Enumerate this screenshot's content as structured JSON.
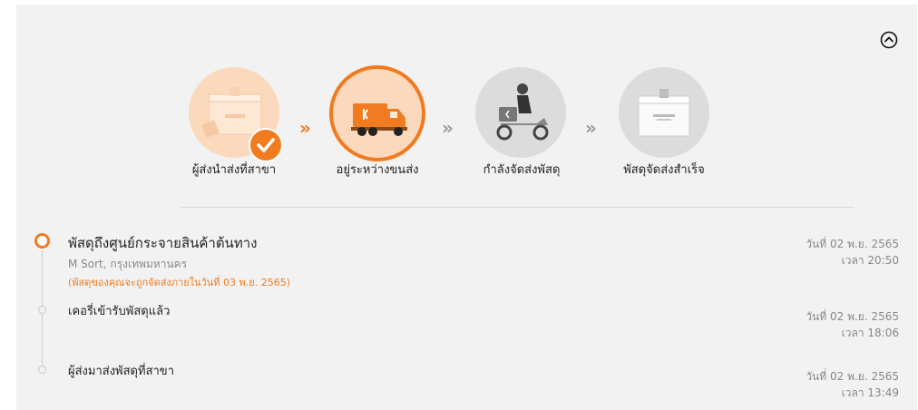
{
  "steps": [
    {
      "label": "ผู้ส่งนำส่งที่สาขา",
      "status": "completed",
      "icon": "parcel-box-icon",
      "badge_icon": "check-icon"
    },
    {
      "label": "อยู่ระหว่างขนส่ง",
      "status": "current",
      "icon": "delivery-truck-icon"
    },
    {
      "label": "กำลังจัดส่งพัสดุ",
      "status": "pending",
      "icon": "motorcycle-courier-icon"
    },
    {
      "label": "พัสดุจัดส่งสำเร็จ",
      "status": "pending",
      "icon": "delivered-box-icon"
    }
  ],
  "arrows": [
    "»",
    "»",
    "»"
  ],
  "colors": {
    "accent": "#f07b20",
    "accent_light": "#fbd9bd",
    "inactive": "#dcdcdc",
    "panel_bg": "#f2f2f2"
  },
  "timeline": [
    {
      "title": "พัสดุถึงศูนย์กระจายสินค้าต้นทาง",
      "location": "M Sort, กรุงเทพมหานคร",
      "note": "(พัสดุของคุณจะถูกจัดส่งภายในวันที่ 03 พ.ย. 2565)",
      "date": "วันที่ 02 พ.ย. 2565",
      "time": "เวลา 20:50",
      "active": true
    },
    {
      "title": "เคอรี่เข้ารับพัสดุแล้ว",
      "date": "วันที่ 02 พ.ย. 2565",
      "time": "เวลา 18:06",
      "active": false
    },
    {
      "title": "ผู้ส่งมาส่งพัสดุที่สาขา",
      "date": "วันที่ 02 พ.ย. 2565",
      "time": "เวลา 13:49",
      "active": false
    }
  ]
}
